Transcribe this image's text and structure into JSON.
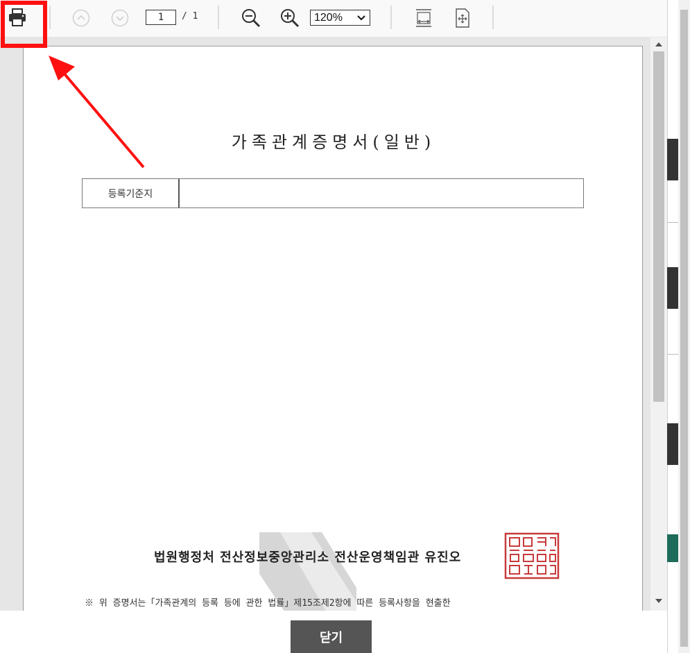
{
  "toolbar": {
    "page_current": "1",
    "page_total": "/ 1",
    "zoom_value": "120%",
    "icons": [
      "print-icon",
      "prev-page-icon",
      "next-page-icon",
      "zoom-out-icon",
      "zoom-in-icon",
      "fit-width-icon",
      "fit-page-icon"
    ]
  },
  "document": {
    "title": "가족관계증명서(일반)",
    "registry_label": "등록기준지",
    "registry_value": "",
    "signer": "법원행정처 전산정보중앙관리소 전산운영책임관 유진오",
    "notice": "※ 위 증명서는「가족관계의 등록 등에 관한 법률」제15조제2항에 따른 등록사항을 현출한"
  },
  "footer": {
    "close_label": "닫기"
  },
  "colors": {
    "highlight": "#ff1010",
    "seal": "#c83a3a",
    "close_button": "#555555"
  }
}
